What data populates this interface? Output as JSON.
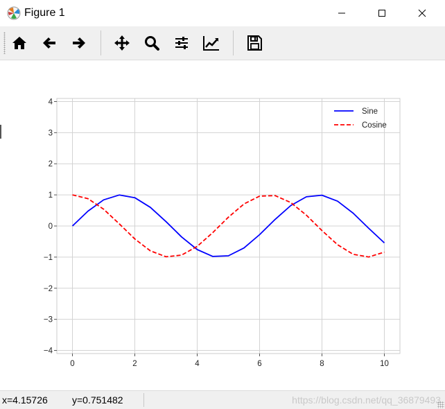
{
  "window": {
    "title": "Figure 1"
  },
  "toolbar": {
    "buttons": [
      {
        "name": "home-button",
        "icon": "home-icon"
      },
      {
        "name": "back-button",
        "icon": "arrow-left-icon"
      },
      {
        "name": "forward-button",
        "icon": "arrow-right-icon"
      },
      {
        "name": "pan-button",
        "icon": "move-icon"
      },
      {
        "name": "zoom-button",
        "icon": "magnifier-icon"
      },
      {
        "name": "configure-subplots-button",
        "icon": "sliders-icon"
      },
      {
        "name": "edit-axes-button",
        "icon": "line-chart-icon"
      },
      {
        "name": "save-button",
        "icon": "floppy-disk-icon"
      }
    ]
  },
  "status": {
    "x_text": "x=4.15726",
    "y_text": "y=0.751482",
    "watermark": "https://blog.csdn.net/qq_36879493"
  },
  "chart_data": {
    "type": "line",
    "xlim": [
      -0.5,
      10.5
    ],
    "ylim": [
      -4.1,
      4.1
    ],
    "xticks": [
      0,
      2,
      4,
      6,
      8,
      10
    ],
    "yticks": [
      -4,
      -3,
      -2,
      -1,
      0,
      1,
      2,
      3,
      4
    ],
    "xtick_labels": [
      "0",
      "2",
      "4",
      "6",
      "8",
      "10"
    ],
    "ytick_labels": [
      "−4",
      "−3",
      "−2",
      "−1",
      "0",
      "1",
      "2",
      "3",
      "4"
    ],
    "grid": true,
    "legend_position": "top-right",
    "x": [
      0,
      0.5,
      1,
      1.5,
      2,
      2.5,
      3,
      3.5,
      4,
      4.5,
      5,
      5.5,
      6,
      6.5,
      7,
      7.5,
      8,
      8.5,
      9,
      9.5,
      10
    ],
    "series": [
      {
        "name": "Sine",
        "color": "#0000ff",
        "dash": "solid",
        "values": [
          0.0,
          0.479,
          0.841,
          0.997,
          0.909,
          0.598,
          0.141,
          -0.351,
          -0.757,
          -0.978,
          -0.959,
          -0.706,
          -0.279,
          0.215,
          0.657,
          0.938,
          0.989,
          0.798,
          0.412,
          -0.075,
          -0.544
        ]
      },
      {
        "name": "Cosine",
        "color": "#ff0000",
        "dash": "dashed",
        "values": [
          1.0,
          0.878,
          0.54,
          0.071,
          -0.416,
          -0.801,
          -0.99,
          -0.936,
          -0.654,
          -0.211,
          0.284,
          0.709,
          0.96,
          0.977,
          0.754,
          0.347,
          -0.146,
          -0.602,
          -0.911,
          -0.997,
          -0.839
        ]
      }
    ]
  }
}
